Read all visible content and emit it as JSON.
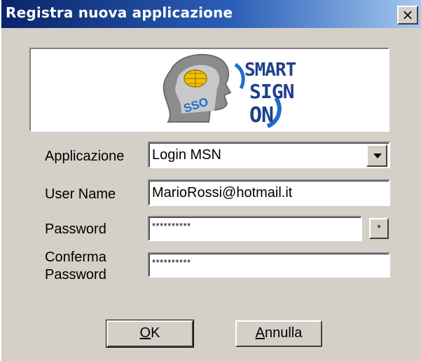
{
  "window": {
    "title": "Registra nuova applicazione",
    "close_label": "×"
  },
  "logo": {
    "alt_text": "SMART SIGN ON",
    "line1": "SMART",
    "line2": "SIGN",
    "line3": "ON",
    "sso": "SSO"
  },
  "form": {
    "application": {
      "label": "Applicazione",
      "value": "Login MSN"
    },
    "username": {
      "label": "User Name",
      "value": "MarioRossi@hotmail.it"
    },
    "password": {
      "label": "Password",
      "value": "**********",
      "button_label": "*"
    },
    "confirm": {
      "label_line1": "Conferma",
      "label_line2": "Password",
      "value": "**********"
    }
  },
  "buttons": {
    "ok": {
      "mnemonic": "O",
      "rest": "K"
    },
    "cancel": {
      "mnemonic": "A",
      "rest": "nnulla"
    }
  },
  "colors": {
    "title_start": "#0a246a",
    "title_end": "#a6caf0",
    "face": "#d4d0c8"
  }
}
